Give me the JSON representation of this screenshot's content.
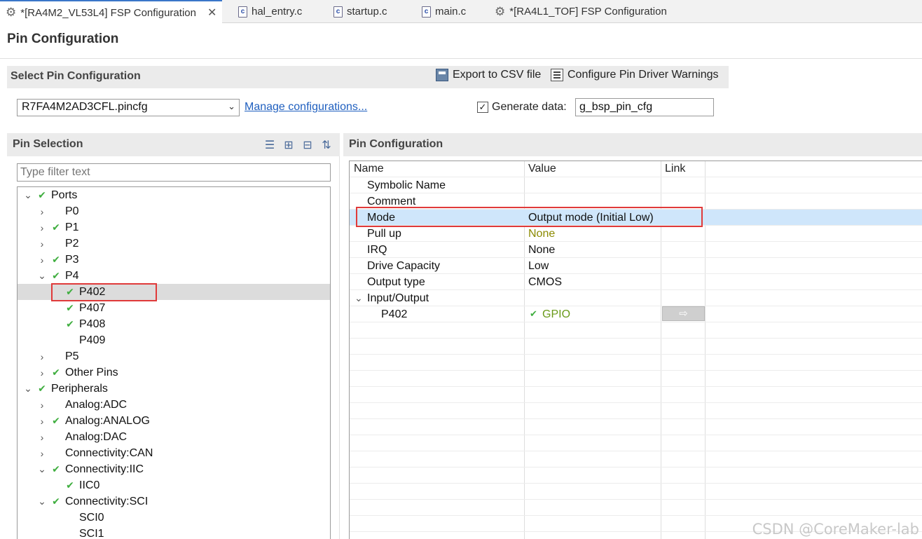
{
  "tabs": [
    {
      "label": "*[RA4M2_VL53L4] FSP Configuration",
      "icon": "gear-icon",
      "active": true,
      "closable": true
    },
    {
      "label": "hal_entry.c",
      "icon": "c-file-icon"
    },
    {
      "label": "startup.c",
      "icon": "c-file-icon"
    },
    {
      "label": "main.c",
      "icon": "c-file-icon"
    },
    {
      "label": "*[RA4L1_TOF] FSP Configuration",
      "icon": "gear-icon"
    }
  ],
  "page_title": "Pin Configuration",
  "select_section": {
    "title": "Select Pin Configuration",
    "export_label": "Export to CSV file",
    "warnings_label": "Configure Pin Driver Warnings",
    "config_value": "R7FA4M2AD3CFL.pincfg",
    "manage_link": "Manage configurations...",
    "generate_label": "Generate data:",
    "generate_checked": true,
    "generate_value": "g_bsp_pin_cfg"
  },
  "pin_selection": {
    "title": "Pin Selection",
    "filter_placeholder": "Type filter text",
    "tree": [
      {
        "label": "Ports",
        "twisty": "open",
        "check": true
      },
      {
        "label": "P0",
        "twisty": "closed",
        "check": false
      },
      {
        "label": "P1",
        "twisty": "closed",
        "check": true
      },
      {
        "label": "P2",
        "twisty": "closed",
        "check": false
      },
      {
        "label": "P3",
        "twisty": "closed",
        "check": true
      },
      {
        "label": "P4",
        "twisty": "open",
        "check": true
      },
      {
        "label": "P402",
        "twisty": "none",
        "check": true,
        "selected": true
      },
      {
        "label": "P407",
        "twisty": "none",
        "check": true
      },
      {
        "label": "P408",
        "twisty": "none",
        "check": true
      },
      {
        "label": "P409",
        "twisty": "none",
        "check": false
      },
      {
        "label": "P5",
        "twisty": "closed",
        "check": false
      },
      {
        "label": "Other Pins",
        "twisty": "closed",
        "check": true
      },
      {
        "label": "Peripherals",
        "twisty": "open",
        "check": true
      },
      {
        "label": "Analog:ADC",
        "twisty": "closed",
        "check": false
      },
      {
        "label": "Analog:ANALOG",
        "twisty": "closed",
        "check": true
      },
      {
        "label": "Analog:DAC",
        "twisty": "closed",
        "check": false
      },
      {
        "label": "Connectivity:CAN",
        "twisty": "closed",
        "check": false
      },
      {
        "label": "Connectivity:IIC",
        "twisty": "open",
        "check": true
      },
      {
        "label": "IIC0",
        "twisty": "none",
        "check": true
      },
      {
        "label": "Connectivity:SCI",
        "twisty": "open",
        "check": true
      },
      {
        "label": "SCI0",
        "twisty": "none",
        "check": false
      },
      {
        "label": "SCI1",
        "twisty": "none",
        "check": false
      }
    ]
  },
  "pin_config": {
    "title": "Pin Configuration",
    "columns": [
      "Name",
      "Value",
      "Link"
    ],
    "rows": [
      {
        "name": "Symbolic Name",
        "value": ""
      },
      {
        "name": "Comment",
        "value": ""
      },
      {
        "name": "Mode",
        "value": "Output mode (Initial Low)",
        "selected": true
      },
      {
        "name": "Pull up",
        "value": "None",
        "value_style": "olive"
      },
      {
        "name": "IRQ",
        "value": "None"
      },
      {
        "name": "Drive Capacity",
        "value": "Low"
      },
      {
        "name": "Output type",
        "value": "CMOS"
      },
      {
        "name": "Input/Output",
        "value": "",
        "twisty": "open"
      },
      {
        "name": "P402",
        "value": "GPIO",
        "value_style": "gpio",
        "link_button": true
      }
    ]
  },
  "watermark": "CSDN @CoreMaker-lab",
  "colors": {
    "accent": "#3a76c9",
    "check": "#3fae3f",
    "highlight": "#e03a3a",
    "selected_row": "#cfe6fb"
  }
}
